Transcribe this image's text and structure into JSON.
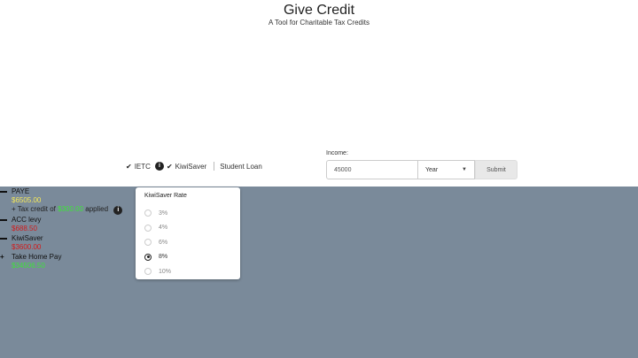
{
  "header": {
    "title": "Give Credit",
    "subtitle": "A Tool for Charitable Tax Credits"
  },
  "options": {
    "ietc_label": "IETC",
    "kiwisaver_label": "KiwiSaver",
    "student_loan_label": "Student Loan"
  },
  "income": {
    "label": "Income:",
    "value": "45000",
    "period": "Year",
    "submit_label": "Submit"
  },
  "results": {
    "paye": {
      "label": "PAYE",
      "value": "$6505.00",
      "credit_prefix": "+ Tax credit of",
      "credit_amount": "$300.00",
      "credit_suffix": "applied"
    },
    "acc": {
      "label": "ACC levy",
      "value": "$688.50"
    },
    "kiwisaver": {
      "label": "KiwiSaver",
      "value": "$3600.00"
    },
    "take_home": {
      "label": "Take Home Pay",
      "value": "$34506.50"
    }
  },
  "kiwisaver_popup": {
    "title": "KiwiSaver Rate",
    "options": [
      "3%",
      "4%",
      "6%",
      "8%",
      "10%"
    ],
    "selected": "8%"
  },
  "colors": {
    "results_bg": "#7a8a9a",
    "paye_value": "#f5e85a",
    "negative": "#d21a1a",
    "positive": "#3ee23a"
  }
}
